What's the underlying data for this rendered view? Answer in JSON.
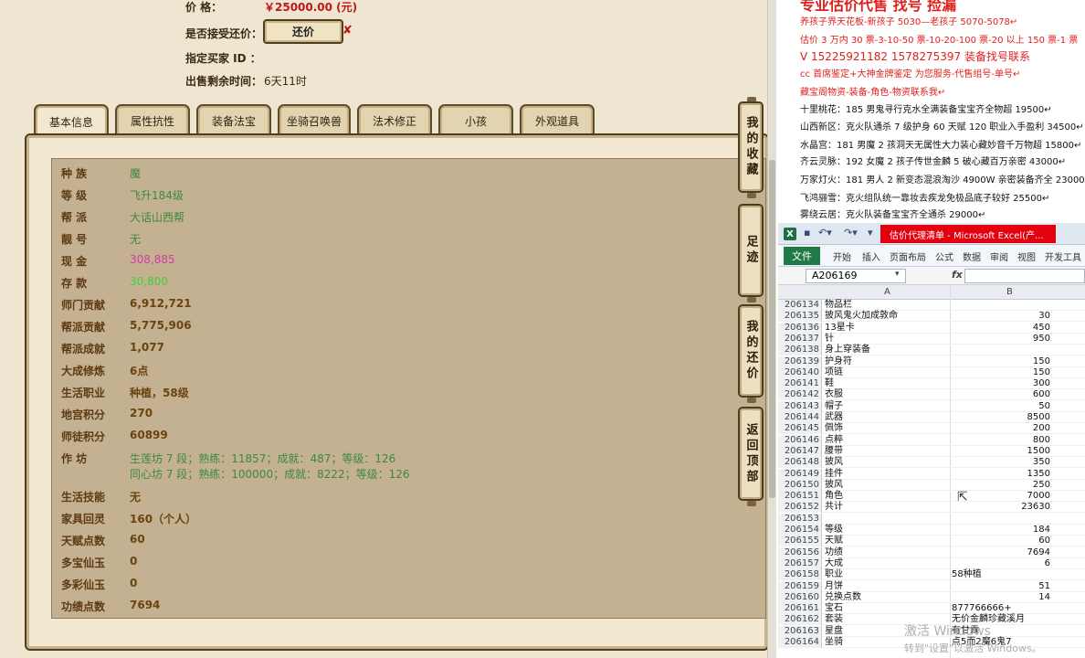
{
  "sell": {
    "price_label": "价  格：",
    "price_value": "￥25000.00 (元)",
    "accept_label": "是否接受还价：",
    "counter_button": "还价",
    "counter_x": "✘",
    "buyer_label": "指定买家 ID ：",
    "time_label": "出售剩余时间：",
    "time_value": "6天11时"
  },
  "tabs": [
    "基本信息",
    "属性抗性",
    "装备法宝",
    "坐骑召唤兽",
    "法术修正",
    "小孩",
    "外观道具"
  ],
  "side_buttons": [
    "我的收藏",
    "足迹",
    "我的还价",
    "返回顶部"
  ],
  "info_rows": [
    {
      "k": "种  族",
      "v": "魔",
      "c": "green"
    },
    {
      "k": "等  级",
      "v": "飞升184级",
      "c": "green"
    },
    {
      "k": "帮  派",
      "v": "大话山西帮",
      "c": "green"
    },
    {
      "k": "靓  号",
      "v": "无",
      "c": "green"
    },
    {
      "k": "现  金",
      "v": "308,885",
      "c": "pink"
    },
    {
      "k": "存  款",
      "v": "30,800",
      "c": "lgreen"
    },
    {
      "k": "师门贡献",
      "v": "6,912,721",
      "c": "brown"
    },
    {
      "k": "帮派贡献",
      "v": "5,775,906",
      "c": "brown"
    },
    {
      "k": "帮派成就",
      "v": "1,077",
      "c": "brown"
    },
    {
      "k": "大成修炼",
      "v": "6点",
      "c": "brown"
    },
    {
      "k": "生活职业",
      "v": "种植，58级",
      "c": "brown"
    },
    {
      "k": "地宫积分",
      "v": "270",
      "c": "brown"
    },
    {
      "k": "师徒积分",
      "v": "60899",
      "c": "brown"
    },
    {
      "k": "作  坊",
      "v": "生莲坊 7 段；熟练：11857；成就：487；等级：126",
      "v2": "同心坊 7 段；熟练：100000；成就：8222；等级：126",
      "c": "green"
    },
    {
      "k": "生活技能",
      "v": "无",
      "c": "brown"
    },
    {
      "k": "家具回灵",
      "v": "160（个人）",
      "c": "brown"
    },
    {
      "k": "天赋点数",
      "v": "60",
      "c": "brown"
    },
    {
      "k": "多宝仙玉",
      "v": "0",
      "c": "brown"
    },
    {
      "k": "多彩仙玉",
      "v": "0",
      "c": "brown"
    },
    {
      "k": "功绩点数",
      "v": "7694",
      "c": "brown"
    }
  ],
  "notes": {
    "title": "专业估价代售 找号 捡漏",
    "lines": [
      {
        "t": "养孩子界天花板-新孩子 5030—老孩子 5070-5078↵",
        "red": true
      },
      {
        "t": "估价 3 万内 30 票-3-10-50 票-10-20-100 票-20 以上 150 票-1 票",
        "red": true
      },
      {
        "t": "V 15225921182      1578275397   装备找号联系",
        "red": true,
        "big": true
      },
      {
        "t": "cc 首席鉴定+大神金牌鉴定 为您服务-代售组号-单号↵",
        "red": true
      },
      {
        "t": "藏宝阁物资-装备-角色-物资联系我↵",
        "red": true
      },
      {
        "t": "十里桃花：185 男鬼寻行克水全满装备宝宝齐全物超 19500↵",
        "red": false
      },
      {
        "t": "山西新区：克火队通杀 7 级护身 60 天赋 120 职业入手盈利 34500↵",
        "red": false
      },
      {
        "t": "水晶宫：181 男魔 2 孩洞天无属性大力装心藏妙音千万物超 15800↵",
        "red": false
      },
      {
        "t": "齐云灵脉：192 女魔 2 孩子传世金麟 5 破心藏百万亲密 43000↵",
        "red": false
      },
      {
        "t": "万家灯火：181 男人 2 新变态混浪淘沙 4900W 亲密装备齐全 23000",
        "red": false
      },
      {
        "t": "飞鸿骊雪：克火组队统一靠妆去疾龙免极品底子较好 25500↵",
        "red": false
      },
      {
        "t": "雾绕云居：克火队装备宝宝齐全通杀 29000↵",
        "red": false
      }
    ]
  },
  "excel": {
    "logo": "X",
    "title": "估价代理清单 - Microsoft Excel(产...",
    "file_tab": "文件",
    "ribbon": [
      "开始",
      "插入",
      "页面布局",
      "公式",
      "数据",
      "审阅",
      "视图",
      "开发工具"
    ],
    "namebox": "A206169",
    "fx": "fx",
    "col_a": "A",
    "col_b": "B",
    "rows": [
      {
        "n": "206134",
        "a": "物品栏",
        "b": ""
      },
      {
        "n": "206135",
        "a": "披风鬼火加成敦命",
        "b": "30"
      },
      {
        "n": "206136",
        "a": "13星卡",
        "b": "450"
      },
      {
        "n": "206137",
        "a": "针",
        "b": "950"
      },
      {
        "n": "206138",
        "a": "身上穿装备",
        "b": ""
      },
      {
        "n": "206139",
        "a": "护身符",
        "b": "150"
      },
      {
        "n": "206140",
        "a": "项链",
        "b": "150"
      },
      {
        "n": "206141",
        "a": "鞋",
        "b": "300"
      },
      {
        "n": "206142",
        "a": "衣服",
        "b": "600"
      },
      {
        "n": "206143",
        "a": "帽子",
        "b": "50"
      },
      {
        "n": "206144",
        "a": "武器",
        "b": "8500"
      },
      {
        "n": "206145",
        "a": "佩饰",
        "b": "200"
      },
      {
        "n": "206146",
        "a": "点粹",
        "b": "800"
      },
      {
        "n": "206147",
        "a": "腰带",
        "b": "1500"
      },
      {
        "n": "206148",
        "a": "披风",
        "b": "350"
      },
      {
        "n": "206149",
        "a": "挂件",
        "b": "1350"
      },
      {
        "n": "206150",
        "a": "披风",
        "b": "250"
      },
      {
        "n": "206151",
        "a": "角色",
        "b": "7000"
      },
      {
        "n": "206152",
        "a": "共计",
        "b": "23630"
      },
      {
        "n": "206153",
        "a": "",
        "b": ""
      },
      {
        "n": "206154",
        "a": "等级",
        "b": "184"
      },
      {
        "n": "206155",
        "a": "天赋",
        "b": "60"
      },
      {
        "n": "206156",
        "a": "功绩",
        "b": "7694"
      },
      {
        "n": "206157",
        "a": "大成",
        "b": "6"
      },
      {
        "n": "206158",
        "a": "职业",
        "bl": "58种植"
      },
      {
        "n": "206159",
        "a": "月饼",
        "b": "51"
      },
      {
        "n": "206160",
        "a": "兑换点数",
        "b": "14"
      },
      {
        "n": "206161",
        "a": "宝石",
        "bl": "877766666+"
      },
      {
        "n": "206162",
        "a": "套装",
        "bl": "无价金麟珍藏溪月"
      },
      {
        "n": "206163",
        "a": "星盘",
        "bl": "有甘霖"
      },
      {
        "n": "206164",
        "a": "坐骑",
        "bl": "点5而2魔6鬼7"
      }
    ]
  },
  "watermark": "激活 Windows",
  "watermark2": "转到\"设置\"以激活 Windows。"
}
